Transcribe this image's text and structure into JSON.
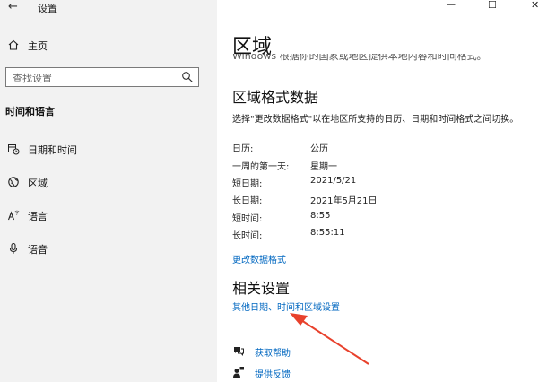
{
  "window": {
    "back_glyph": "←",
    "title": "设置",
    "minimize_glyph": "—",
    "maximize_glyph": "☐",
    "close_glyph": "✕"
  },
  "sidebar": {
    "home_label": "主页",
    "search_placeholder": "查找设置",
    "section_title": "时间和语言",
    "items": [
      {
        "label": "日期和时间",
        "icon": "calendar-clock-icon"
      },
      {
        "label": "区域",
        "icon": "globe-icon"
      },
      {
        "label": "语言",
        "icon": "language-icon"
      },
      {
        "label": "语音",
        "icon": "microphone-icon"
      }
    ]
  },
  "main": {
    "title": "区域",
    "cut_text": "Windows 根据你的国家或地区提供本地内容和时间格式。",
    "format_heading": "区域格式数据",
    "format_desc": "选择\"更改数据格式\"以在地区所支持的日历、日期和时间格式之间切换。",
    "rows": [
      {
        "label": "日历:",
        "value": "公历"
      },
      {
        "label": "一周的第一天:",
        "value": "星期一"
      },
      {
        "label": "短日期:",
        "value": "2021/5/21"
      },
      {
        "label": "长日期:",
        "value": "2021年5月21日"
      },
      {
        "label": "短时间:",
        "value": "8:55"
      },
      {
        "label": "长时间:",
        "value": "8:55:11"
      }
    ],
    "change_format_link": "更改数据格式",
    "related_heading": "相关设置",
    "related_link": "其他日期、时间和区域设置",
    "help_link": "获取帮助",
    "feedback_link": "提供反馈"
  },
  "colors": {
    "accent": "#0067c0",
    "annotation_arrow": "#e8412c",
    "sidebar_bg": "#f2f2f2"
  }
}
